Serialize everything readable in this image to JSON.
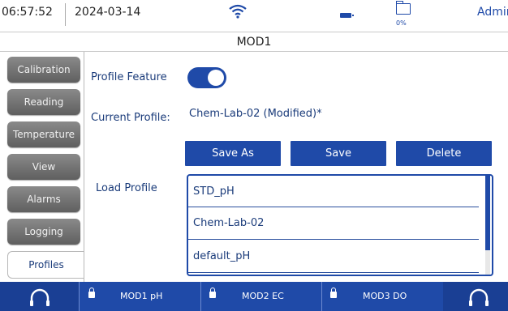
{
  "status_bar": {
    "time": "06:57:52",
    "date": "2024-03-14",
    "storage_percent": "0%",
    "user": "Admin",
    "icons": [
      "wifi-icon",
      "battery-icon",
      "folder-icon"
    ]
  },
  "module_title": "MOD1",
  "sidebar": {
    "tabs": [
      {
        "label": "Calibration"
      },
      {
        "label": "Reading"
      },
      {
        "label": "Temperature"
      },
      {
        "label": "View"
      },
      {
        "label": "Alarms"
      },
      {
        "label": "Logging"
      },
      {
        "label": "Profiles",
        "active": true
      }
    ]
  },
  "profiles": {
    "feature_label": "Profile Feature",
    "feature_enabled": true,
    "current_label": "Current Profile:",
    "current_value": "Chem-Lab-02 (Modified)*",
    "buttons": {
      "save_as": "Save As",
      "save": "Save",
      "delete": "Delete"
    },
    "load_label": "Load Profile",
    "load_list": [
      "STD_pH",
      "Chem-Lab-02",
      "default_pH"
    ]
  },
  "bottom_bar": {
    "channels": [
      "MOD1 pH",
      "MOD2 EC",
      "MOD3 DO"
    ]
  },
  "colors": {
    "accent": "#1f4aa8",
    "text": "#1a3b7a",
    "tab_inactive": "#707070"
  }
}
